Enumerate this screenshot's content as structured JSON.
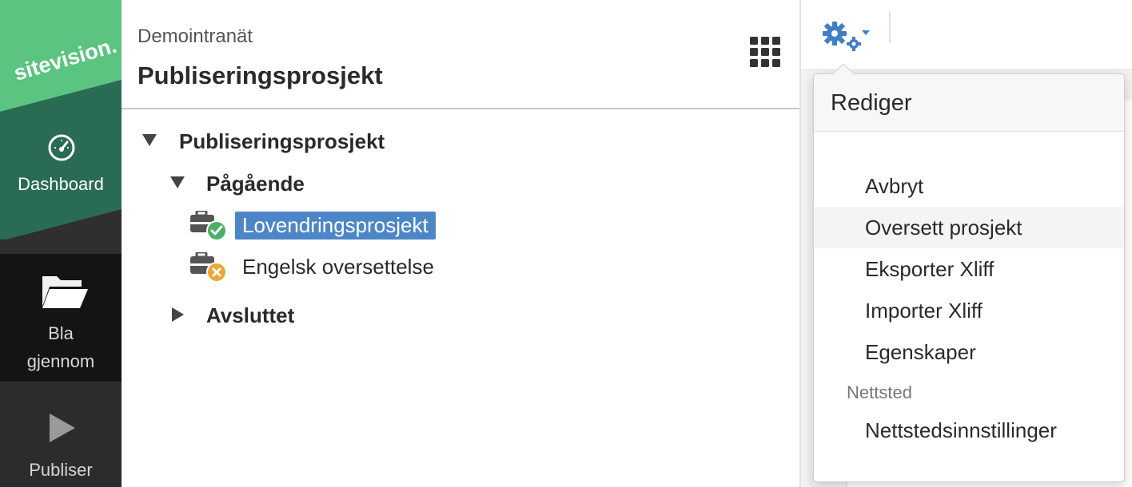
{
  "sidebar": {
    "logo_text": "sitevision.",
    "dashboard_label": "Dashboard",
    "browse_label_line1": "Bla",
    "browse_label_line2": "gjennom",
    "publish_label": "Publiser"
  },
  "header": {
    "site_name": "Demointranät",
    "title": "Publiseringsprosjekt"
  },
  "tree": {
    "root_label": "Publiseringsprosjekt",
    "ongoing_label": "Pågående",
    "projects": [
      {
        "label": "Lovendringsprosjekt",
        "status": "approved",
        "selected": true
      },
      {
        "label": "Engelsk oversettelse",
        "status": "rejected",
        "selected": false
      }
    ],
    "finished_label": "Avsluttet"
  },
  "menu": {
    "title": "Rediger",
    "items": [
      {
        "label": "Avbryt"
      },
      {
        "label": "Oversett prosjekt"
      },
      {
        "label": "Eksporter Xliff"
      },
      {
        "label": "Importer Xliff"
      },
      {
        "label": "Egenskaper"
      }
    ],
    "section_label": "Nettsted",
    "section_items": [
      {
        "label": "Nettstedsinnstillinger"
      }
    ]
  },
  "colors": {
    "accent": "#4d86c7",
    "brand_green": "#5bc480",
    "brand_dark_green": "#2a6b54",
    "approved_badge": "#4caf67",
    "rejected_badge": "#e9a63a",
    "gear": "#3f7ec6"
  },
  "icons": {
    "dashboard": "gauge-icon",
    "browse": "folder-open-icon",
    "publish": "play-icon",
    "apps": "grid-icon",
    "settings": "gears-icon",
    "project": "briefcase-icon"
  }
}
